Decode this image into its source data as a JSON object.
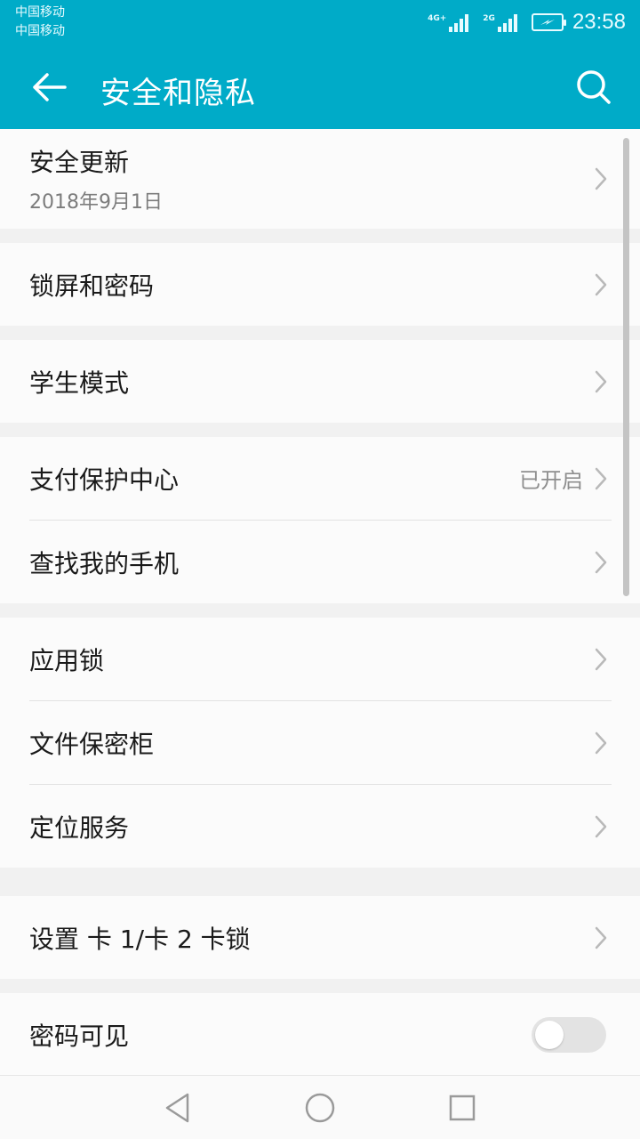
{
  "colors": {
    "accent": "#00abc8"
  },
  "status_bar": {
    "carrier_1": "中国移动",
    "carrier_2": "中国移动",
    "network_1": "4G+",
    "network_2": "2G",
    "time": "23:58",
    "icons": [
      "signal-icon",
      "signal-icon",
      "battery-charging-icon"
    ]
  },
  "app_bar": {
    "title": "安全和隐私",
    "back_icon": "arrow-left-icon",
    "search_icon": "search-icon"
  },
  "settings": {
    "security_update": {
      "label": "安全更新",
      "sub": "2018年9月1日"
    },
    "lock_screen": {
      "label": "锁屏和密码"
    },
    "student_mode": {
      "label": "学生模式"
    },
    "payment_protection": {
      "label": "支付保护中心",
      "value": "已开启"
    },
    "find_phone": {
      "label": "查找我的手机"
    },
    "app_lock": {
      "label": "应用锁"
    },
    "file_safe": {
      "label": "文件保密柜"
    },
    "location": {
      "label": "定位服务"
    },
    "sim_lock": {
      "label": "设置 卡 1/卡 2 卡锁"
    },
    "password_visible": {
      "label": "密码可见",
      "enabled": false
    }
  },
  "nav_bar": {
    "icons": [
      "back-triangle-icon",
      "home-circle-icon",
      "recents-square-icon"
    ]
  }
}
